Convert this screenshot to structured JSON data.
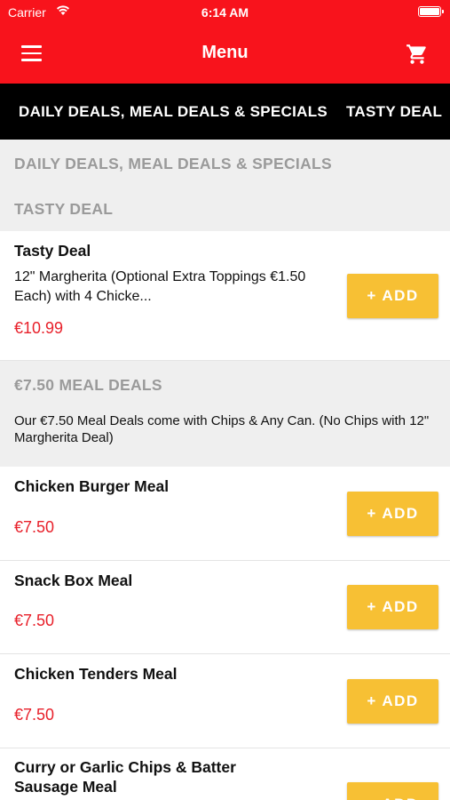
{
  "status_bar": {
    "carrier": "Carrier",
    "time": "6:14 AM"
  },
  "nav": {
    "title": "Menu"
  },
  "category_tabs": [
    "DAILY DEALS, MEAL DEALS & SPECIALS",
    "TASTY DEAL"
  ],
  "sections": [
    {
      "title": "DAILY DEALS, MEAL DEALS & SPECIALS"
    },
    {
      "title": "TASTY DEAL"
    },
    {
      "title": "€7.50 MEAL DEALS",
      "description": "Our €7.50 Meal Deals come with Chips & Any Can. (No Chips with 12\" Margherita Deal)"
    }
  ],
  "items": [
    {
      "name": "Tasty Deal",
      "description": "12\" Margherita (Optional Extra Toppings €1.50 Each) with 4 Chicke...",
      "price": "€10.99"
    },
    {
      "name": "Chicken Burger Meal",
      "price": "€7.50"
    },
    {
      "name": "Snack Box Meal",
      "price": "€7.50"
    },
    {
      "name": "Chicken Tenders Meal",
      "price": "€7.50"
    },
    {
      "name": "Curry or Garlic Chips & Batter Sausage Meal"
    }
  ],
  "add_label": "+ ADD",
  "colors": {
    "brand_red": "#f8131c",
    "add_button": "#f7c034",
    "price_red": "#e8202a",
    "section_bg": "#efefef"
  }
}
